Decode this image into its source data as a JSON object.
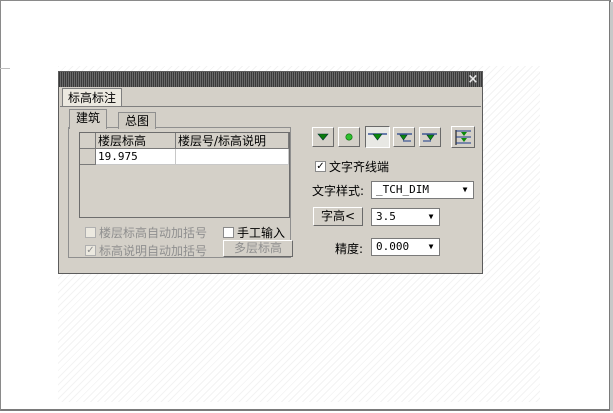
{
  "dialog": {
    "title_tab": "标高标注",
    "close_label": "×"
  },
  "tabs": {
    "architecture": "建筑",
    "general_plan": "总图"
  },
  "grid": {
    "columns": [
      "楼层标高",
      "楼层号/标高说明"
    ],
    "rows": [
      {
        "elevation": "19.975",
        "floor_note": ""
      }
    ]
  },
  "options": {
    "auto_bracket_floor_elevation": "楼层标高自动加括号",
    "auto_bracket_floor_elevation_checked": false,
    "manual_input": "手工输入",
    "manual_input_checked": false,
    "auto_bracket_elevation_note": "标高说明自动加括号",
    "auto_bracket_elevation_note_checked": true,
    "multi_floor_button": "多层标高"
  },
  "symbol_buttons": [
    {
      "icon": "elevation-filled-triangle-icon",
      "pressed": false
    },
    {
      "icon": "elevation-dot-icon",
      "pressed": false
    },
    {
      "icon": "elevation-triangle-line-icon",
      "pressed": true
    },
    {
      "icon": "elevation-right-flag-icon",
      "pressed": false
    },
    {
      "icon": "elevation-left-flag-icon",
      "pressed": false
    },
    {
      "icon": "elevation-multi-level-icon",
      "pressed": false
    }
  ],
  "text_align": {
    "label": "文字齐线端",
    "checked": true
  },
  "text_style": {
    "label": "文字样式:",
    "value": "_TCH_DIM"
  },
  "font_height": {
    "button_label": "字高<",
    "value": "3.5"
  },
  "precision": {
    "label": "精度:",
    "value": "0.000"
  },
  "colors": {
    "accent_green": "#0a8a0a",
    "dialog_bg": "#d4d0c8"
  }
}
